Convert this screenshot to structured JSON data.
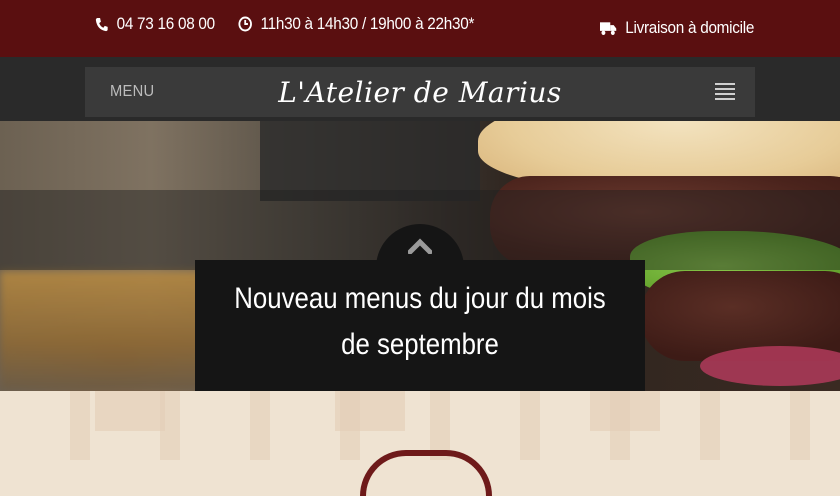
{
  "topbar": {
    "phone": "04 73 16 08 00",
    "hours": "11h30 à 14h30 / 19h00 à 22h30*",
    "delivery": "Livraison à domicile",
    "icons": {
      "phone": "phone-icon",
      "hours": "clock-icon",
      "delivery": "truck-icon"
    }
  },
  "nav": {
    "menu_label": "MENU",
    "brand": "L'Atelier de Marius",
    "toggle_icon": "hamburger-icon"
  },
  "hero": {
    "caption": "Nouveau menus du jour du mois de septembre",
    "scroll_icon": "chevron-up-icon"
  },
  "colors": {
    "topbar": "#5a0f10",
    "nav": "#2a2a2a",
    "caption_bg": "#151515"
  }
}
